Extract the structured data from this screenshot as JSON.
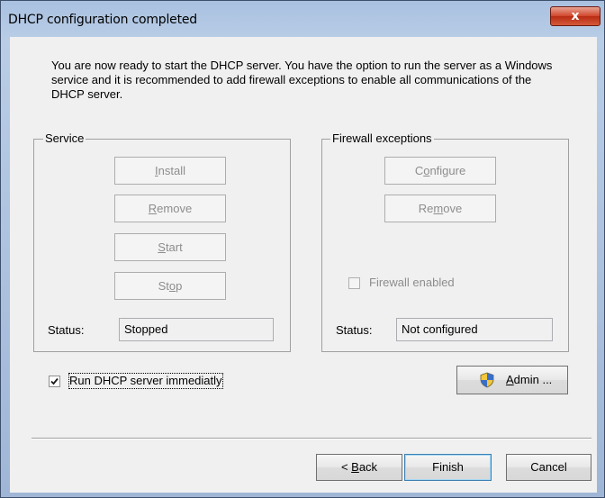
{
  "window": {
    "title": "DHCP configuration completed",
    "close_glyph": "x"
  },
  "intro": "You are now ready to start the DHCP server. You have the option to run the server as a Windows service and it is recommended to add firewall exceptions to enable all communications of the DHCP server.",
  "service": {
    "group_label": "Service",
    "install": {
      "mnemonic": "I",
      "rest": "nstall"
    },
    "remove": {
      "mnemonic": "R",
      "rest": "emove"
    },
    "start": {
      "mnemonic": "S",
      "rest": "tart"
    },
    "stop": {
      "pre": "St",
      "mnemonic": "o",
      "rest": "p"
    },
    "status_label": "Status:",
    "status_value": "Stopped"
  },
  "firewall": {
    "group_label": "Firewall exceptions",
    "configure": {
      "pre": "C",
      "mnemonic": "o",
      "rest": "nfigure"
    },
    "remove": {
      "pre": "Re",
      "mnemonic": "m",
      "rest": "ove"
    },
    "enabled_label": "Firewall enabled",
    "enabled_checked": false,
    "status_label": "Status:",
    "status_value": "Not configured"
  },
  "run_immediately": {
    "label": "Run DHCP server immediatly",
    "checked": true
  },
  "admin": {
    "mnemonic": "A",
    "rest": "dmin ..."
  },
  "footer": {
    "back": {
      "pre": "< ",
      "mnemonic": "B",
      "rest": "ack"
    },
    "finish": "Finish",
    "cancel": "Cancel"
  },
  "colors": {
    "title_bar": "#b9cde6",
    "close_button": "#c8452b",
    "dialog_bg": "#f0f0f0"
  }
}
